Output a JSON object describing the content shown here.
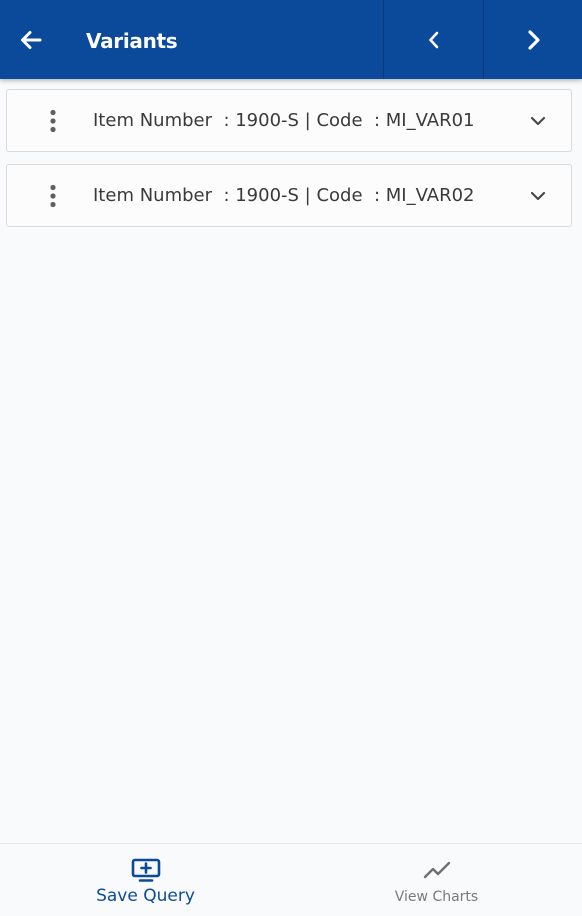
{
  "header": {
    "title": "Variants",
    "background_color": "#0b4a9b",
    "back_icon": "arrow-left-icon",
    "prev_icon": "chevron-left-icon",
    "next_icon": "chevron-right-icon"
  },
  "variants": [
    {
      "text": "Item Number  : 1900-S | Code  : MI_VAR01",
      "menu_icon": "more-vertical-icon",
      "expand_icon": "chevron-down-icon"
    },
    {
      "text": "Item Number  : 1900-S | Code  : MI_VAR02",
      "menu_icon": "more-vertical-icon",
      "expand_icon": "chevron-down-icon"
    }
  ],
  "bottom_nav": {
    "save_query": {
      "label": "Save Query",
      "icon": "monitor-plus-icon",
      "color": "#0b4a9b"
    },
    "view_charts": {
      "label": "View Charts",
      "icon": "trending-line-icon",
      "color": "#7a7a7a"
    }
  }
}
